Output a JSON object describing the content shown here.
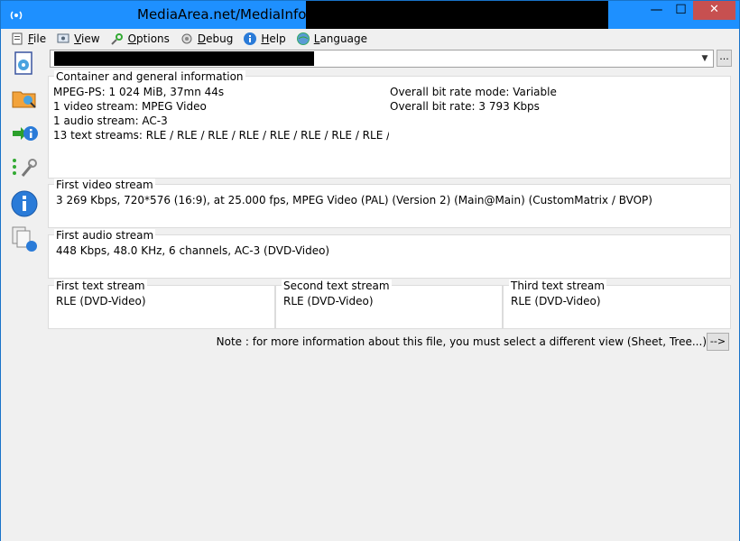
{
  "window": {
    "title": "MediaArea.net/MediaInfo -",
    "minimize": "—",
    "maximize": "☐",
    "close": "✕"
  },
  "menu": [
    {
      "label": "File",
      "icon": "file-icon"
    },
    {
      "label": "View",
      "icon": "view-icon"
    },
    {
      "label": "Options",
      "icon": "options-icon"
    },
    {
      "label": "Debug",
      "icon": "debug-icon"
    },
    {
      "label": "Help",
      "icon": "help-icon"
    },
    {
      "label": "Language",
      "icon": "language-icon"
    }
  ],
  "toolbar": {
    "icons": [
      "open-file-icon",
      "open-folder-icon",
      "export-icon",
      "preferences-icon",
      "about-icon",
      "knowledge-base-icon"
    ]
  },
  "file_combo": {
    "browse_label": "..."
  },
  "general": {
    "title": "Container and general information",
    "left": [
      "MPEG-PS: 1 024 MiB, 37mn 44s",
      "1 video stream: MPEG Video",
      "1 audio stream: AC-3",
      "13 text streams: RLE / RLE / RLE / RLE / RLE / RLE / RLE / RLE / RLI"
    ],
    "right": [
      "Overall bit rate mode: Variable",
      "Overall bit rate: 3 793 Kbps"
    ]
  },
  "video": {
    "title": "First video stream",
    "text": "3 269 Kbps, 720*576 (16:9), at 25.000 fps, MPEG Video (PAL) (Version 2) (Main@Main) (CustomMatrix / BVOP)"
  },
  "audio": {
    "title": "First audio stream",
    "text": "448 Kbps, 48.0 KHz, 6 channels, AC-3 (DVD-Video)"
  },
  "text_streams": [
    {
      "title": "First text stream",
      "text": "RLE (DVD-Video)"
    },
    {
      "title": "Second text stream",
      "text": "RLE (DVD-Video)"
    },
    {
      "title": "Third text stream",
      "text": "RLE (DVD-Video)"
    }
  ],
  "note": {
    "text": "Note : for more information about this file, you must select a different view (Sheet, Tree...)",
    "button_label": "-->"
  }
}
